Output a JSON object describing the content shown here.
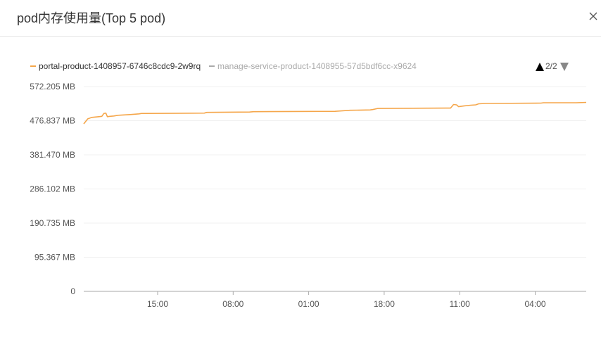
{
  "dialog": {
    "title": "pod内存使用量(Top 5 pod)",
    "close_icon": "close-icon"
  },
  "legend": {
    "items": [
      {
        "label": "portal-product-1408957-6746c8cdc9-2w9rq",
        "color": "#f5a64a",
        "active": true
      },
      {
        "label": "manage-service-product-1408955-57d5bdf6cc-x9624",
        "color": "#aaaaaa",
        "active": false
      }
    ],
    "pager": {
      "text": "2/2",
      "up_icon": "triangle-up-icon",
      "down_icon": "triangle-down-icon",
      "up_color": "#000000",
      "down_color": "#888888"
    }
  },
  "chart_data": {
    "type": "line",
    "y_ticks": [
      "572.205 MB",
      "476.837 MB",
      "381.470 MB",
      "286.102 MB",
      "190.735 MB",
      "95.367 MB",
      "0"
    ],
    "ylim": [
      0,
      572.205
    ],
    "x_ticks": [
      "15:00",
      "08:00",
      "01:00",
      "18:00",
      "11:00",
      "04:00"
    ],
    "grid": true,
    "legend_placement": "top-left",
    "series": [
      {
        "name": "portal-product-1408957-6746c8cdc9-2w9rq",
        "color": "#f5a64a",
        "points": [
          [
            0.0,
            468
          ],
          [
            0.008,
            482
          ],
          [
            0.016,
            486
          ],
          [
            0.03,
            488
          ],
          [
            0.036,
            489
          ],
          [
            0.04,
            497
          ],
          [
            0.044,
            498
          ],
          [
            0.047,
            488
          ],
          [
            0.052,
            489
          ],
          [
            0.06,
            490
          ],
          [
            0.068,
            492
          ],
          [
            0.08,
            493
          ],
          [
            0.092,
            494
          ],
          [
            0.11,
            496
          ],
          [
            0.115,
            497
          ],
          [
            0.124,
            497
          ],
          [
            0.24,
            498
          ],
          [
            0.245,
            500
          ],
          [
            0.33,
            501
          ],
          [
            0.338,
            502
          ],
          [
            0.5,
            503
          ],
          [
            0.52,
            505
          ],
          [
            0.53,
            506
          ],
          [
            0.57,
            507
          ],
          [
            0.575,
            508
          ],
          [
            0.585,
            511
          ],
          [
            0.72,
            512
          ],
          [
            0.73,
            512
          ],
          [
            0.736,
            522
          ],
          [
            0.742,
            521
          ],
          [
            0.746,
            516
          ],
          [
            0.756,
            518
          ],
          [
            0.77,
            520
          ],
          [
            0.78,
            521
          ],
          [
            0.786,
            524
          ],
          [
            0.8,
            525
          ],
          [
            0.91,
            526
          ],
          [
            0.915,
            527
          ],
          [
            0.98,
            527
          ],
          [
            1.0,
            528
          ]
        ]
      }
    ]
  }
}
